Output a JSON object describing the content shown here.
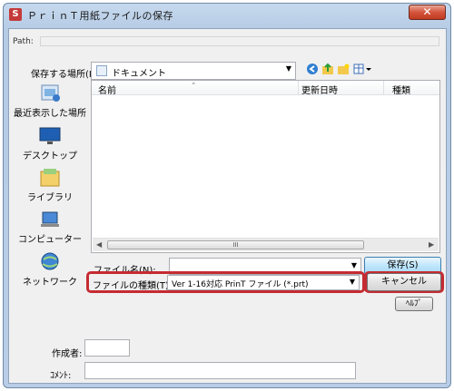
{
  "window": {
    "title": "ＰｒｉｎＴ用紙ファイルの保存",
    "close_glyph": "✕"
  },
  "path": {
    "label": "Path:",
    "value": ""
  },
  "save_in": {
    "label": "保存する場所(I):",
    "value": "ドキュメント"
  },
  "toolbar": {
    "icons": [
      "back-icon",
      "up-folder-icon",
      "new-folder-icon",
      "view-menu-icon"
    ]
  },
  "places": [
    {
      "label": "最近表示した場所",
      "icon": "recent-places-icon"
    },
    {
      "label": "デスクトップ",
      "icon": "desktop-icon"
    },
    {
      "label": "ライブラリ",
      "icon": "libraries-icon"
    },
    {
      "label": "コンピューター",
      "icon": "computer-icon"
    },
    {
      "label": "ネットワーク",
      "icon": "network-icon"
    }
  ],
  "file_list": {
    "columns": [
      "名前",
      "更新日時",
      "種類"
    ],
    "sort_indicator": "˄",
    "scroll_grip": "III",
    "rows": []
  },
  "file_name": {
    "label": "ファイル名(N):",
    "value": ""
  },
  "file_type": {
    "label": "ファイルの種類(T):",
    "value": "Ver 1-16対応 PrinT ファイル (*.prt)"
  },
  "buttons": {
    "save": "保存(S)",
    "cancel": "キャンセル",
    "help": "ﾍﾙﾌﾟ"
  },
  "author": {
    "label": "作成者:",
    "value": ""
  },
  "comment": {
    "label": "ｺﾒﾝﾄ:",
    "value": ""
  },
  "colors": {
    "highlight": "#c52b32",
    "titlebar": "#b9cde6",
    "close_button": "#c03a20"
  }
}
